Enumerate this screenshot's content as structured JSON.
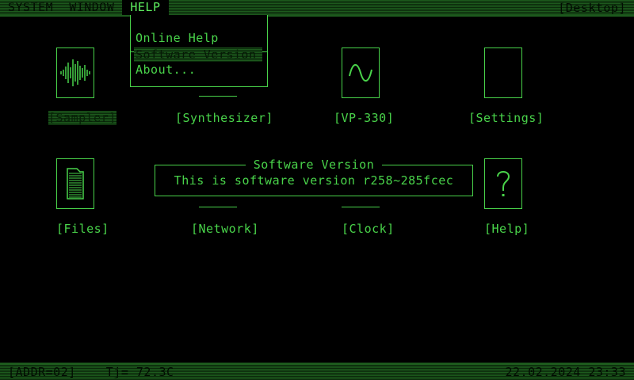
{
  "menu_bar": {
    "items": [
      {
        "label": "SYSTEM"
      },
      {
        "label": "WINDOW"
      },
      {
        "label": "HELP"
      }
    ],
    "context": "[Desktop]"
  },
  "help_menu": {
    "items": [
      {
        "label": "Online Help"
      },
      {
        "label": "Software Version"
      },
      {
        "label": "About..."
      }
    ],
    "highlighted": "Software Version"
  },
  "desktop": {
    "icons": [
      {
        "label": "[Sampler]",
        "icon": "waveform-icon",
        "selected": true
      },
      {
        "label": "[Synthesizer]",
        "icon": "synthesizer-icon"
      },
      {
        "label": "[VP-330]",
        "icon": "sine-wave-icon"
      },
      {
        "label": "[Settings]",
        "icon": "settings-icon"
      },
      {
        "label": "[Files]",
        "icon": "file-stack-icon"
      },
      {
        "label": "[Network]",
        "icon": "network-icon"
      },
      {
        "label": "[Clock]",
        "icon": "clock-icon"
      },
      {
        "label": "[Help]",
        "icon": "question-mark-icon"
      }
    ]
  },
  "dialog": {
    "title": "Software Version",
    "message": "This is software version r258~285fcec"
  },
  "status_bar": {
    "address": "[ADDR=02]",
    "temperature": "Tj= 72.3C",
    "datetime": "22.02.2024 23:33"
  },
  "colors": {
    "phosphor": "#49d34a",
    "background": "#000000",
    "bar": "#1d5a1d"
  }
}
